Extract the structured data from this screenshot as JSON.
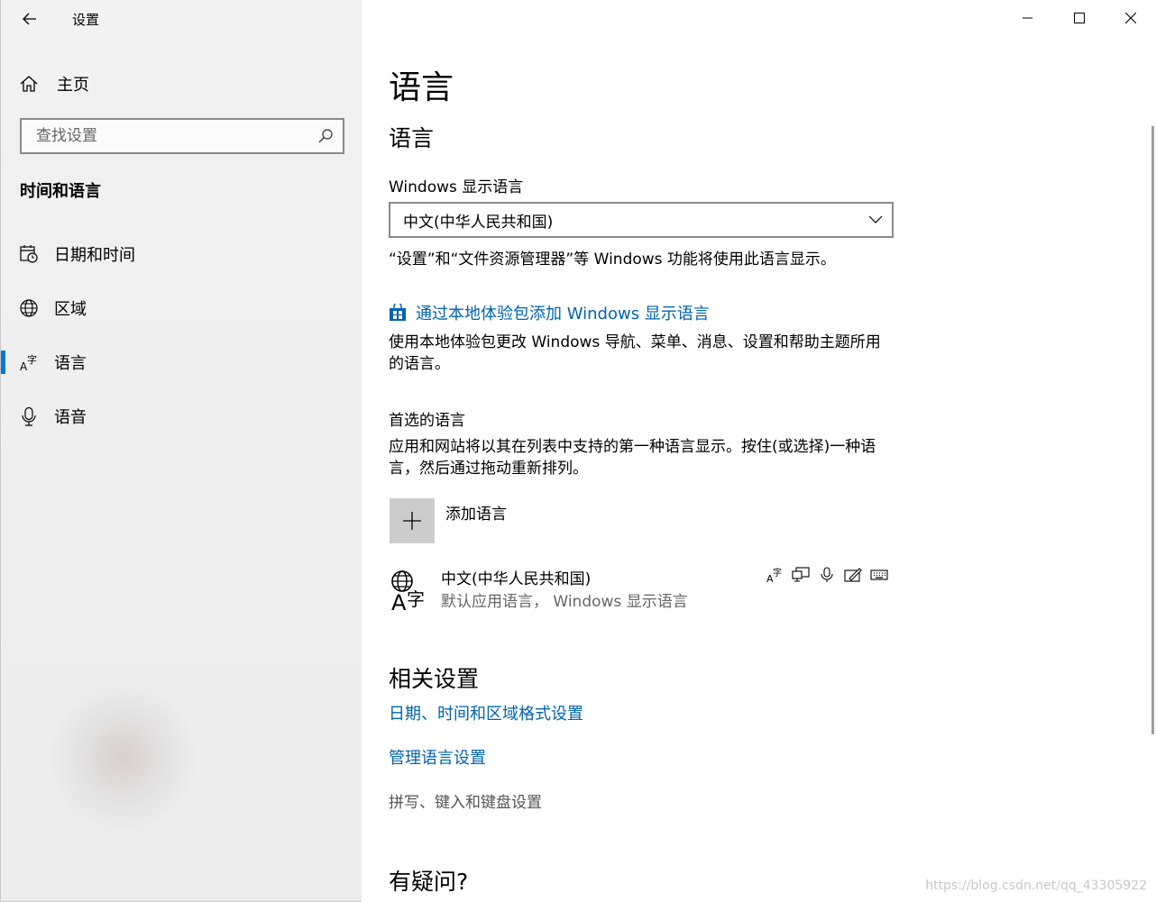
{
  "window": {
    "app_title": "设置"
  },
  "sidebar": {
    "home_label": "主页",
    "search_placeholder": "查找设置",
    "section_title": "时间和语言",
    "items": [
      {
        "label": "日期和时间",
        "icon": "calendar-clock-icon",
        "active": false
      },
      {
        "label": "区域",
        "icon": "globe-icon",
        "active": false
      },
      {
        "label": "语言",
        "icon": "language-icon",
        "active": true
      },
      {
        "label": "语音",
        "icon": "microphone-icon",
        "active": false
      }
    ]
  },
  "main": {
    "page_title": "语言",
    "language_section": {
      "heading": "语言",
      "display_language_label": "Windows 显示语言",
      "display_language_value": "中文(中华人民共和国)",
      "display_language_desc": "“设置”和“文件资源管理器”等 Windows 功能将使用此语言显示。",
      "store_link": "通过本地体验包添加 Windows 显示语言",
      "store_desc": "使用本地体验包更改 Windows 导航、菜单、消息、设置和帮助主题所用的语言。"
    },
    "preferred": {
      "heading": "首选的语言",
      "desc": "应用和网站将以其在列表中支持的第一种语言显示。按住(或选择)一种语言，然后通过拖动重新排列。",
      "add_label": "添加语言",
      "languages": [
        {
          "name": "中文(中华人民共和国)",
          "subtitle": "默认应用语言， Windows 显示语言",
          "features": [
            "display-language-icon",
            "text-to-speech-icon",
            "speech-recognition-icon",
            "handwriting-icon",
            "keyboard-icon"
          ]
        }
      ]
    },
    "related": {
      "heading": "相关设置",
      "link_1": "日期、时间和区域格式设置",
      "link_2": "管理语言设置",
      "disabled_item": "拼写、键入和键盘设置"
    },
    "help": {
      "heading": "有疑问?"
    }
  },
  "watermark": "https://blog.csdn.net/qq_43305922",
  "colors": {
    "accent": "#0078d7",
    "link": "#0063b1",
    "sidebar_bg": "#f0f0f0"
  }
}
